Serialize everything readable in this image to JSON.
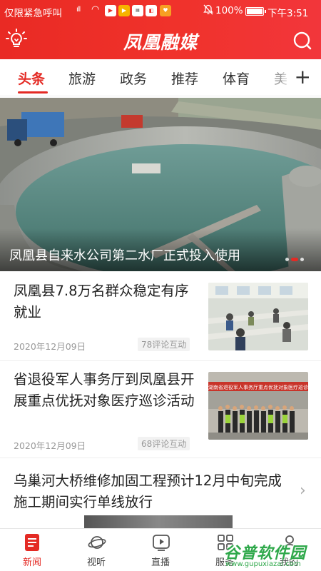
{
  "status_bar": {
    "carrier_text": "仅限紧急呼叫",
    "signal": "ıll",
    "wifi": "◠",
    "battery_percent": "100%",
    "time": "下午3:51"
  },
  "header": {
    "brand_title": "凤凰融媒",
    "bulb_icon": "lightbulb-icon",
    "search_icon": "search-icon",
    "colors": {
      "brand_red": "#e92a24"
    }
  },
  "tabs": {
    "items": [
      {
        "label": "头条",
        "active": true
      },
      {
        "label": "旅游",
        "active": false
      },
      {
        "label": "政务",
        "active": false
      },
      {
        "label": "推荐",
        "active": false
      },
      {
        "label": "体育",
        "active": false
      },
      {
        "label": "美",
        "active": false
      }
    ],
    "plus_icon": "+"
  },
  "banner": {
    "caption": "凤凰县自来水公司第二水厂正式投入使用",
    "slide_count": 3,
    "active_slide": 2
  },
  "news": [
    {
      "title": "凤凰县7.8万名群众稳定有序就业",
      "date": "2020年12月09日",
      "comments": "78评论互动"
    },
    {
      "title": "省退役军人事务厅到凤凰县开展重点优抚对象医疗巡诊活动",
      "date": "2020年12月09日",
      "comments": "68评论互动",
      "thumb_banner_text": "湖南省退役军人事务厅重点优抚对象医疗巡诊"
    },
    {
      "title": "乌巢河大桥维修加固工程预计12月中旬完成 施工期间实行单线放行"
    }
  ],
  "bottom_nav": {
    "items": [
      {
        "label": "新闻",
        "icon": "news-icon",
        "active": true
      },
      {
        "label": "视听",
        "icon": "planet-icon",
        "active": false
      },
      {
        "label": "直播",
        "icon": "play-icon",
        "active": false
      },
      {
        "label": "服务",
        "icon": "grid-icon",
        "active": false
      },
      {
        "label": "我的",
        "icon": "user-icon",
        "active": false
      }
    ]
  },
  "watermark": {
    "title": "谷普软件园",
    "url": "www.gupuxiazai.com"
  }
}
